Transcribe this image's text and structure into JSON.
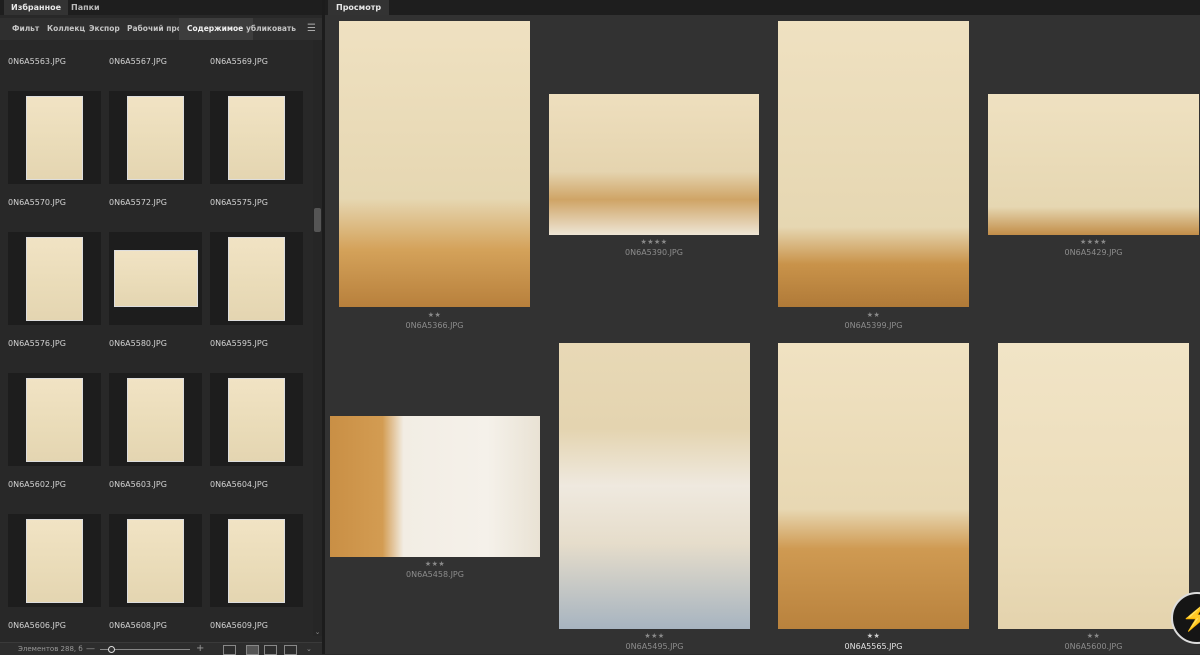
{
  "left_panel": {
    "top_tabs": [
      "Избранное",
      "Папки"
    ],
    "sub_tabs": [
      "Фильт",
      "Коллекц",
      "Экспор",
      "Рабочий прос",
      "Содержимое",
      "убликовать"
    ],
    "active_sub_tab": "Содержимое",
    "top_row_names": [
      "0N6A5563.JPG",
      "0N6A5567.JPG",
      "0N6A5569.JPG"
    ],
    "thumbnail_rows": [
      [
        "0N6A5570.JPG",
        "0N6A5572.JPG",
        "0N6A5575.JPG"
      ],
      [
        "0N6A5576.JPG",
        "0N6A5580.JPG",
        "0N6A5595.JPG"
      ],
      [
        "0N6A5602.JPG",
        "0N6A5603.JPG",
        "0N6A5604.JPG"
      ],
      [
        "0N6A5606.JPG",
        "0N6A5608.JPG",
        "0N6A5609.JPG"
      ]
    ],
    "bottom_bar": {
      "count_text": "Элементов 288, б",
      "minus": "—",
      "plus": "+"
    }
  },
  "preview": {
    "tab_label": "Просмотр",
    "photos": [
      {
        "stars": "★★",
        "name": "0N6A5366.JPG",
        "selected": false
      },
      {
        "stars": "★★★★",
        "name": "0N6A5390.JPG",
        "selected": false
      },
      {
        "stars": "★★",
        "name": "0N6A5399.JPG",
        "selected": false
      },
      {
        "stars": "★★★★",
        "name": "0N6A5429.JPG",
        "selected": false
      },
      {
        "stars": "★★★",
        "name": "0N6A5458.JPG",
        "selected": false
      },
      {
        "stars": "★★★",
        "name": "0N6A5495.JPG",
        "selected": false
      },
      {
        "stars": "★★",
        "name": "0N6A5565.JPG",
        "selected": true
      },
      {
        "stars": "★★",
        "name": "0N6A5600.JPG",
        "selected": false
      }
    ]
  }
}
